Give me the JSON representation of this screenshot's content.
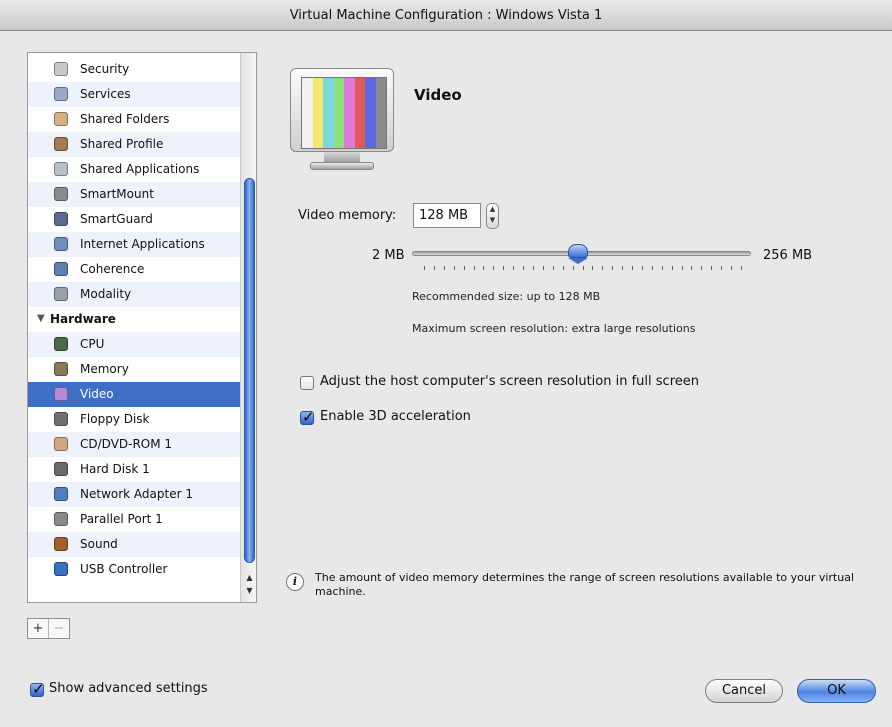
{
  "window": {
    "title": "Virtual Machine Configuration : Windows Vista 1"
  },
  "sidebar": {
    "items": [
      {
        "label": "Security",
        "icon": "security-shield-icon",
        "color": "#c8c8c8"
      },
      {
        "label": "Services",
        "icon": "services-icon",
        "color": "#9aa9c9"
      },
      {
        "label": "Shared Folders",
        "icon": "shared-folders-icon",
        "color": "#d8b080"
      },
      {
        "label": "Shared Profile",
        "icon": "shared-profile-icon",
        "color": "#a07a50"
      },
      {
        "label": "Shared Applications",
        "icon": "shared-applications-icon",
        "color": "#b8c0c8"
      },
      {
        "label": "SmartMount",
        "icon": "smartmount-icon",
        "color": "#8a8a8a"
      },
      {
        "label": "SmartGuard",
        "icon": "smartguard-icon",
        "color": "#5a6a90"
      },
      {
        "label": "Internet Applications",
        "icon": "internet-applications-icon",
        "color": "#6f8fbf"
      },
      {
        "label": "Coherence",
        "icon": "coherence-icon",
        "color": "#5f7fb0"
      },
      {
        "label": "Modality",
        "icon": "modality-icon",
        "color": "#9aa0a8"
      }
    ],
    "group": {
      "label": "Hardware"
    },
    "hardware_items": [
      {
        "label": "CPU",
        "icon": "cpu-icon",
        "color": "#4a6a4a"
      },
      {
        "label": "Memory",
        "icon": "memory-icon",
        "color": "#8a7a5a"
      },
      {
        "label": "Video",
        "icon": "video-icon",
        "color": "#b58ad8",
        "selected": true
      },
      {
        "label": "Floppy Disk",
        "icon": "floppy-disk-icon",
        "color": "#707070"
      },
      {
        "label": "CD/DVD-ROM 1",
        "icon": "cd-dvd-icon",
        "color": "#d0a880"
      },
      {
        "label": "Hard Disk 1",
        "icon": "hard-disk-icon",
        "color": "#6a6a6a"
      },
      {
        "label": "Network Adapter 1",
        "icon": "network-adapter-icon",
        "color": "#4d7fc0"
      },
      {
        "label": "Parallel Port 1",
        "icon": "parallel-port-icon",
        "color": "#8a8a8a"
      },
      {
        "label": "Sound",
        "icon": "sound-icon",
        "color": "#a0602a"
      },
      {
        "label": "USB Controller",
        "icon": "usb-controller-icon",
        "color": "#3a70c0"
      }
    ]
  },
  "add_remove": {
    "add": "+",
    "remove": "−"
  },
  "panel": {
    "title": "Video",
    "monitor_colors": [
      "#f2f2f2",
      "#f4e86a",
      "#7ad8e0",
      "#8fe07a",
      "#e07ad8",
      "#e05a5a",
      "#5a6ae0",
      "#8a8a8a"
    ],
    "video_memory_label": "Video memory:",
    "video_memory_value": "128 MB",
    "slider_min": "2 MB",
    "slider_max": "256 MB",
    "slider_fraction": 0.49,
    "recommended": "Recommended size:  up to 128 MB",
    "max_resolution": "Maximum screen resolution:  extra large resolutions",
    "adjust_resolution": {
      "label": "Adjust the host computer's screen resolution in full screen",
      "checked": false
    },
    "enable_3d": {
      "label": "Enable 3D acceleration",
      "checked": true
    },
    "info": "The amount of video memory determines the range of screen resolutions available to your virtual machine."
  },
  "footer": {
    "show_advanced": {
      "label": "Show advanced settings",
      "checked": true
    },
    "cancel": "Cancel",
    "ok": "OK"
  }
}
